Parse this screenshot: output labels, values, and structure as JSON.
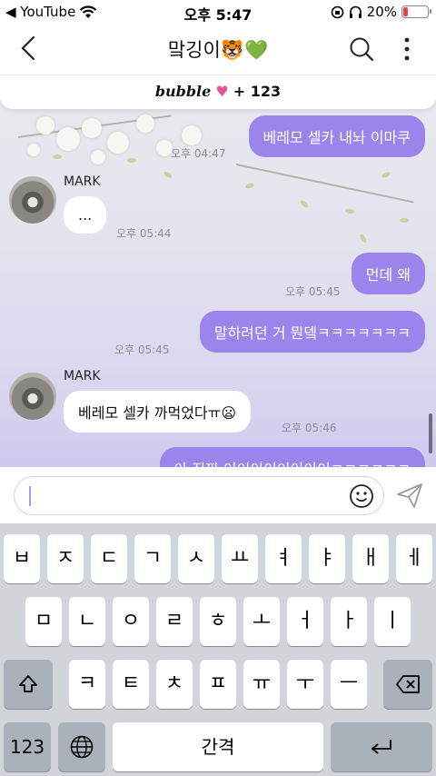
{
  "status_bar": {
    "carrier_label": "◀ YouTube",
    "time": "오후 5:47",
    "battery_text": "20%",
    "battery_level": 0.2
  },
  "header": {
    "title": "맠깅이🐯💚"
  },
  "subbar": {
    "brand": "bubble",
    "heart": "♥",
    "count": "+ 123"
  },
  "messages": [
    {
      "dir": "out",
      "text": "베레모 셀카 내놔 이마쿠",
      "time": "오후 04:47"
    },
    {
      "dir": "in",
      "sender": "MARK",
      "text": "...",
      "time": "오후 05:44"
    },
    {
      "dir": "out",
      "text": "먼데 왜",
      "time": "오후 05:45"
    },
    {
      "dir": "out",
      "text": "말하려던 거 뭔뎈ㅋㅋㅋㅋㅋㅋㅋ",
      "time": "오후 05:45"
    },
    {
      "dir": "in",
      "sender": "MARK",
      "text": "베레모 셀카 까먹었다ㅠ😦",
      "time": "오후 05:46"
    },
    {
      "dir": "out",
      "text": "아 진짜 이이이이이이이이ㅋㅋㅋㅋㅋㅋ",
      "time": ""
    }
  ],
  "input": {
    "value": ""
  },
  "keyboard": {
    "row1": [
      "ㅂ",
      "ㅈ",
      "ㄷ",
      "ㄱ",
      "ㅅ",
      "ㅛ",
      "ㅕ",
      "ㅑ",
      "ㅐ",
      "ㅔ"
    ],
    "row2": [
      "ㅁ",
      "ㄴ",
      "ㅇ",
      "ㄹ",
      "ㅎ",
      "ㅗ",
      "ㅓ",
      "ㅏ",
      "ㅣ"
    ],
    "row3": [
      "ㅋ",
      "ㅌ",
      "ㅊ",
      "ㅍ",
      "ㅠ",
      "ㅜ",
      "ㅡ"
    ],
    "numbers_label": "123",
    "space_label": "간격"
  }
}
